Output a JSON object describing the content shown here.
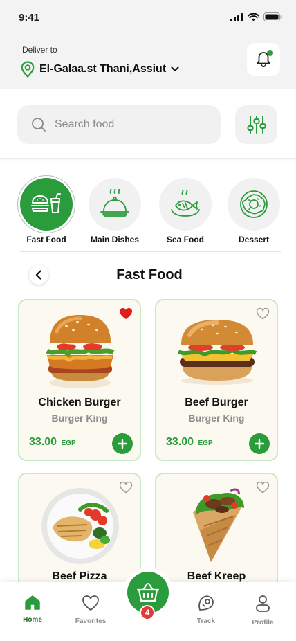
{
  "status": {
    "time": "9:41"
  },
  "header": {
    "deliver_label": "Deliver to",
    "location": "El-Galaa.st Thani,Assiut"
  },
  "search": {
    "placeholder": "Search food",
    "value": ""
  },
  "categories": [
    {
      "label": "Fast Food",
      "icon": "fast-food-icon",
      "active": true
    },
    {
      "label": "Main Dishes",
      "icon": "cloche-icon",
      "active": false
    },
    {
      "label": "Sea Food",
      "icon": "fish-icon",
      "active": false
    },
    {
      "label": "Dessert",
      "icon": "donut-icon",
      "active": false
    }
  ],
  "section": {
    "title": "Fast Food"
  },
  "products": [
    {
      "name": "Chicken Burger",
      "brand": "Burger King",
      "price": "33.00",
      "currency": "EGP",
      "favorite": true,
      "image": "chicken-burger-image"
    },
    {
      "name": "Beef Burger",
      "brand": "Burger King",
      "price": "33.00",
      "currency": "EGP",
      "favorite": false,
      "image": "beef-burger-image"
    },
    {
      "name": "Beef Pizza",
      "brand": "",
      "price": "",
      "currency": "",
      "favorite": false,
      "image": "grilled-fish-plate-image"
    },
    {
      "name": "Beef Kreep",
      "brand": "",
      "price": "",
      "currency": "",
      "favorite": false,
      "image": "wrap-image"
    }
  ],
  "nav": {
    "home": "Home",
    "favorites": "Favorites",
    "track": "Track",
    "profile": "Profile",
    "cart_count": "4"
  },
  "colors": {
    "accent": "#2a9c3c",
    "card_border": "#c8eac8",
    "card_bg": "#fbf9f0",
    "badge": "#e23a3a",
    "favorite": "#e01e1e"
  }
}
